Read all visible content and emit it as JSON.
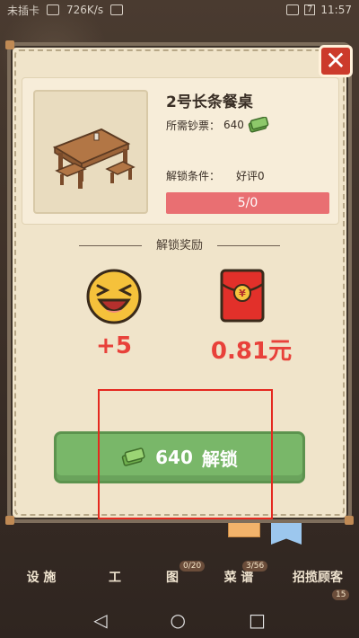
{
  "status_bar": {
    "carrier": "未插卡",
    "speed": "726K/s",
    "battery": "7",
    "time": "11:57"
  },
  "dialog": {
    "close_icon": "close-icon",
    "item": {
      "title": "2号长条餐桌",
      "price_label": "所需钞票：",
      "price_value": "640",
      "condition_label": "解锁条件：",
      "condition_value": "好评0",
      "progress_text": "5/0",
      "progress_fraction": 0
    },
    "rewards": {
      "title": "解锁奖励",
      "likes": "+5",
      "cash": "0.81元"
    },
    "unlock_button": {
      "amount": "640",
      "label": "解锁"
    }
  },
  "bottom_nav": {
    "facility_label": "设 施",
    "staff_label": "工",
    "gallery_label": "图",
    "gallery_badge": "0/20",
    "menu_label": "菜 谱",
    "menu_badge": "3/56",
    "recruit_label": "招揽顾客",
    "recruit_badge": "15"
  },
  "colors": {
    "accent_red": "#e8413a",
    "button_green": "#79b769",
    "progress_pink": "#e96f72"
  }
}
